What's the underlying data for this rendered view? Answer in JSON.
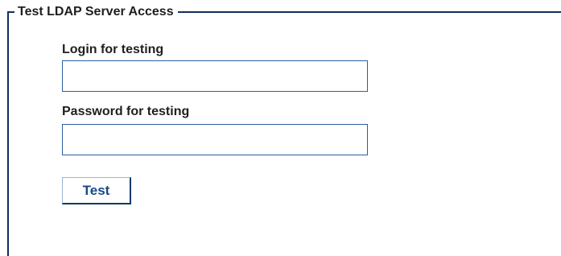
{
  "group": {
    "title": "Test LDAP Server Access"
  },
  "login": {
    "label": "Login for testing",
    "value": ""
  },
  "password": {
    "label": "Password for testing",
    "value": ""
  },
  "actions": {
    "test_label": "Test"
  },
  "colors": {
    "group_border": "#0f2f5c",
    "input_border": "#2b5f9e",
    "button_text": "#174a8c",
    "button_shadow": "#15396b"
  }
}
